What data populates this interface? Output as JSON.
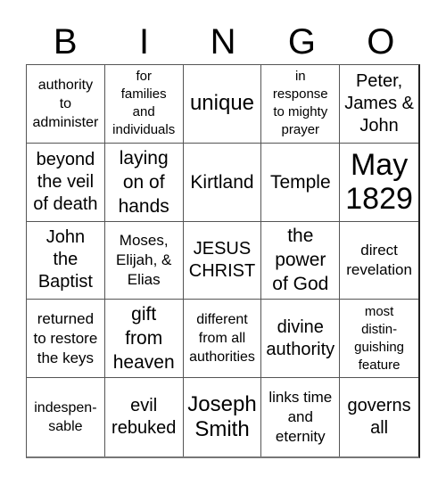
{
  "header": {
    "letters": [
      "B",
      "I",
      "N",
      "G",
      "O"
    ]
  },
  "board": {
    "rows": [
      [
        "authority\nto\nadminister",
        "for\nfamilies\nand\nindividuals",
        "unique",
        "in\nresponse\nto mighty\nprayer",
        "Peter,\nJames &\nJohn"
      ],
      [
        "beyond\nthe veil\nof death",
        "laying\non of\nhands",
        "Kirtland",
        "Temple",
        "May\n1829"
      ],
      [
        "John\nthe\nBaptist",
        "Moses,\nElijah, &\nElias",
        "JESUS\nCHRIST",
        "the\npower\nof God",
        "direct\nrevelation"
      ],
      [
        "returned\nto restore\nthe keys",
        "gift\nfrom\nheaven",
        "different\nfrom all\nauthorities",
        "divine\nauthority",
        "most\ndistin-\nguishing\nfeature"
      ],
      [
        "indespen-\nsable",
        "evil\nrebuked",
        "Joseph\nSmith",
        "links time\nand\neternity",
        "governs\nall"
      ]
    ]
  }
}
